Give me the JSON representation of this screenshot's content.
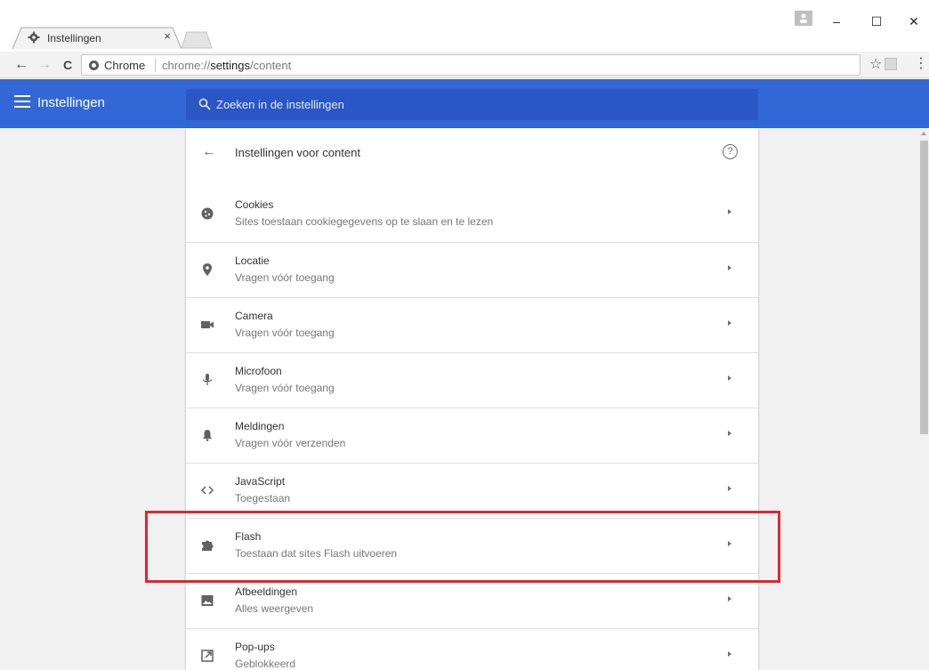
{
  "browser": {
    "tab_title": "Instellingen",
    "tab_close": "×",
    "window_minimize": "–",
    "window_maximize": "☐",
    "window_close": "✕",
    "secure_label": "Chrome",
    "url_prefix": "chrome://",
    "url_host": "settings",
    "url_path": "/content",
    "nav_back": "←",
    "nav_forward": "→",
    "nav_reload": "C",
    "bookmark_star": "☆",
    "menu": "⋮"
  },
  "header": {
    "title": "Instellingen",
    "search_placeholder": "Zoeken in de instellingen",
    "color": "#3367d6"
  },
  "subpage": {
    "title": "Instellingen voor content",
    "back": "←",
    "help": "?"
  },
  "rows": [
    {
      "title": "Cookies",
      "subtitle": "Sites toestaan cookiegegevens op te slaan en te lezen",
      "icon": "cookie-icon"
    },
    {
      "title": "Locatie",
      "subtitle": "Vragen vóór toegang",
      "icon": "location-icon"
    },
    {
      "title": "Camera",
      "subtitle": "Vragen vóór toegang",
      "icon": "camera-icon"
    },
    {
      "title": "Microfoon",
      "subtitle": "Vragen vóór toegang",
      "icon": "microphone-icon"
    },
    {
      "title": "Meldingen",
      "subtitle": "Vragen vóór verzenden",
      "icon": "bell-icon"
    },
    {
      "title": "JavaScript",
      "subtitle": "Toegestaan",
      "icon": "code-icon"
    },
    {
      "title": "Flash",
      "subtitle": "Toestaan dat sites Flash uitvoeren",
      "icon": "puzzle-icon"
    },
    {
      "title": "Afbeeldingen",
      "subtitle": "Alles weergeven",
      "icon": "image-icon"
    },
    {
      "title": "Pop-ups",
      "subtitle": "Geblokkeerd",
      "icon": "popup-icon"
    }
  ],
  "highlight_color": "#e0262d"
}
